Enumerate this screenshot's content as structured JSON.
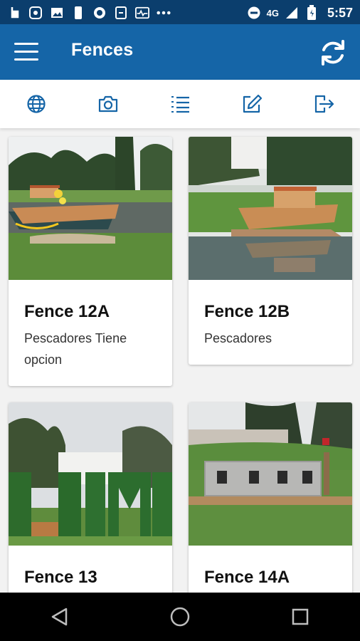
{
  "status_bar": {
    "time": "5:57",
    "network": "4G"
  },
  "app_bar": {
    "title": "Fences"
  },
  "toolbar": {
    "icons": [
      "globe-icon",
      "camera-icon",
      "list-icon",
      "edit-icon",
      "export-icon"
    ]
  },
  "cards": [
    {
      "title": "Fence 12A",
      "subtitle": "Pescadores Tiene opcion"
    },
    {
      "title": "Fence 12B",
      "subtitle": "Pescadores"
    },
    {
      "title": "Fence 13",
      "subtitle": ""
    },
    {
      "title": "Fence 14A",
      "subtitle": ""
    }
  ],
  "colors": {
    "status_bar": "#0b3e6d",
    "app_bar": "#1565a7",
    "icon_blue": "#1565a7"
  }
}
